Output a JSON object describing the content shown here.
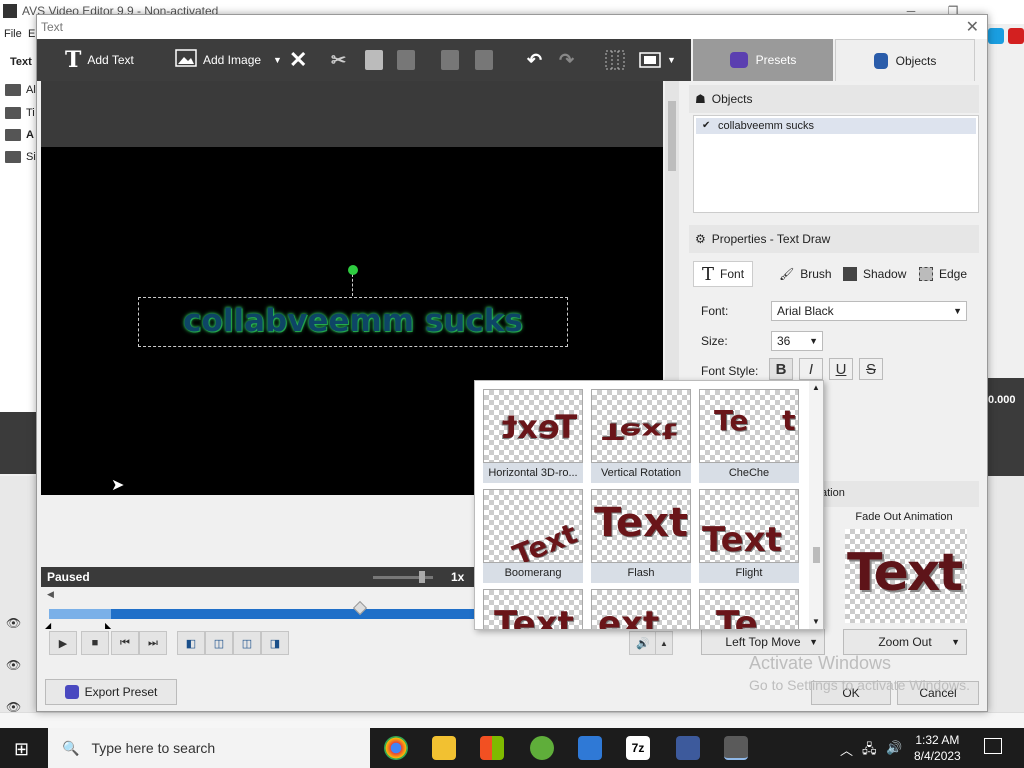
{
  "background_app": {
    "title": "AVS Video Editor 9.9 - Non-activated",
    "menu": [
      "File",
      "E"
    ],
    "left_label": "Text",
    "folders": [
      "Al",
      "Ti",
      "A",
      "Si"
    ],
    "right_value": "0.000"
  },
  "dialog": {
    "title": "Text",
    "toolbar": {
      "add_text": "Add Text",
      "add_image": "Add Image"
    },
    "tabs": {
      "presets": "Presets",
      "objects": "Objects"
    },
    "preview": {
      "text": "collabveemm sucks",
      "status": "Paused",
      "speed": "1x"
    },
    "objects_panel": {
      "header": "Objects",
      "items": [
        {
          "label": "collabveemm sucks",
          "checked": true
        }
      ]
    },
    "properties": {
      "header": "Properties - Text Draw",
      "tabs": [
        "Font",
        "Brush",
        "Shadow",
        "Edge"
      ],
      "font_label": "Font:",
      "font_value": "Arial Black",
      "size_label": "Size:",
      "size_value": "36",
      "style_label": "Font Style:",
      "style_buttons": [
        "B",
        "I",
        "U",
        "S"
      ]
    },
    "animation": {
      "partial_label": "ation",
      "fade_out_label": "Fade Out Animation",
      "fade_out_preview": "Text",
      "in_select": "Left Top Move",
      "out_select": "Zoom Out"
    },
    "effects": [
      {
        "label": "Horizontal 3D-ro...",
        "preview": "Text"
      },
      {
        "label": "Vertical Rotation",
        "preview": "Text"
      },
      {
        "label": "CheChe",
        "preview": "Te t"
      },
      {
        "label": "Boomerang",
        "preview": "Text"
      },
      {
        "label": "Flash",
        "preview": "Text"
      },
      {
        "label": "Flight",
        "preview": "Text"
      },
      {
        "label": "",
        "preview": "Text"
      },
      {
        "label": "",
        "preview": "ext"
      },
      {
        "label": "",
        "preview": "Te"
      }
    ],
    "export_preset": "Export Preset",
    "ok": "OK",
    "cancel": "Cancel",
    "watermark_title": "Activate Windows",
    "watermark_sub": "Go to Settings to activate Windows."
  },
  "taskbar": {
    "search_placeholder": "Type here to search",
    "time": "1:32 AM",
    "date": "8/4/2023"
  },
  "colors": {
    "toolbar": "#3d3d3d",
    "stage": "#000000",
    "timeline": "#1f6fc8",
    "text_fill": "#0e4566",
    "text_glow": "#2cc35a",
    "preset_text": "#6a1519"
  }
}
